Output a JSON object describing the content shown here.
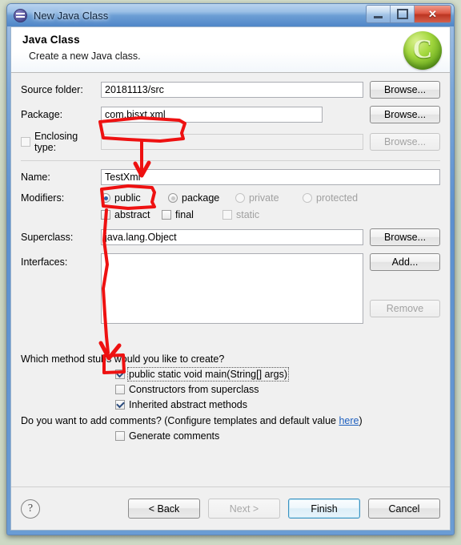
{
  "window": {
    "title": "New Java Class",
    "icon": "java-class-icon",
    "buttons": {
      "minimize": "minimize-button",
      "maximize": "maximize-button",
      "close": "✕"
    }
  },
  "header": {
    "title": "Java Class",
    "subtitle": "Create a new Java class.",
    "logo": "C"
  },
  "form": {
    "source_folder": {
      "label": "Source folder:",
      "value": "20181113/src",
      "browse": "Browse..."
    },
    "package": {
      "label": "Package:",
      "value": "com.bjsxt.xml",
      "browse": "Browse..."
    },
    "enclosing_type": {
      "label": "Enclosing type:",
      "value": "",
      "browse": "Browse...",
      "checked": false
    },
    "name": {
      "label": "Name:",
      "value": "TestXml"
    },
    "modifiers": {
      "label": "Modifiers:",
      "access": [
        {
          "label": "public",
          "selected": true,
          "enabled": true
        },
        {
          "label": "package",
          "selected": false,
          "enabled": true
        },
        {
          "label": "private",
          "selected": false,
          "enabled": false
        },
        {
          "label": "protected",
          "selected": false,
          "enabled": false
        }
      ],
      "flags": [
        {
          "label": "abstract",
          "checked": false,
          "enabled": true
        },
        {
          "label": "final",
          "checked": false,
          "enabled": true
        },
        {
          "label": "static",
          "checked": false,
          "enabled": false
        }
      ]
    },
    "superclass": {
      "label": "Superclass:",
      "value": "java.lang.Object",
      "browse": "Browse..."
    },
    "interfaces": {
      "label": "Interfaces:",
      "value": "",
      "add": "Add...",
      "remove": "Remove"
    }
  },
  "stubs": {
    "question": "Which method stubs would you like to create?",
    "items": [
      {
        "label": "public static void main(String[] args)",
        "checked": true,
        "enabled": true,
        "focused": true
      },
      {
        "label": "Constructors from superclass",
        "checked": false,
        "enabled": true,
        "focused": false
      },
      {
        "label": "Inherited abstract methods",
        "checked": true,
        "enabled": true,
        "focused": false
      }
    ]
  },
  "comments": {
    "question_prefix": "Do you want to add comments? (Configure templates and default value ",
    "link": "here",
    "question_suffix": ")",
    "checkbox": {
      "label": "Generate comments",
      "checked": false
    }
  },
  "footer": {
    "help": "?",
    "back": "< Back",
    "next": "Next >",
    "finish": "Finish",
    "cancel": "Cancel"
  },
  "annotations": {
    "color": "#ee1111",
    "box_package": "red-box-around-package-value",
    "box_name": "red-box-around-name-value",
    "box_main_checkbox": "red-box-around-main-checkbox",
    "arrow_package_to_name": "red-arrow-down",
    "arrow_name_to_main": "red-arrow-down-long"
  }
}
